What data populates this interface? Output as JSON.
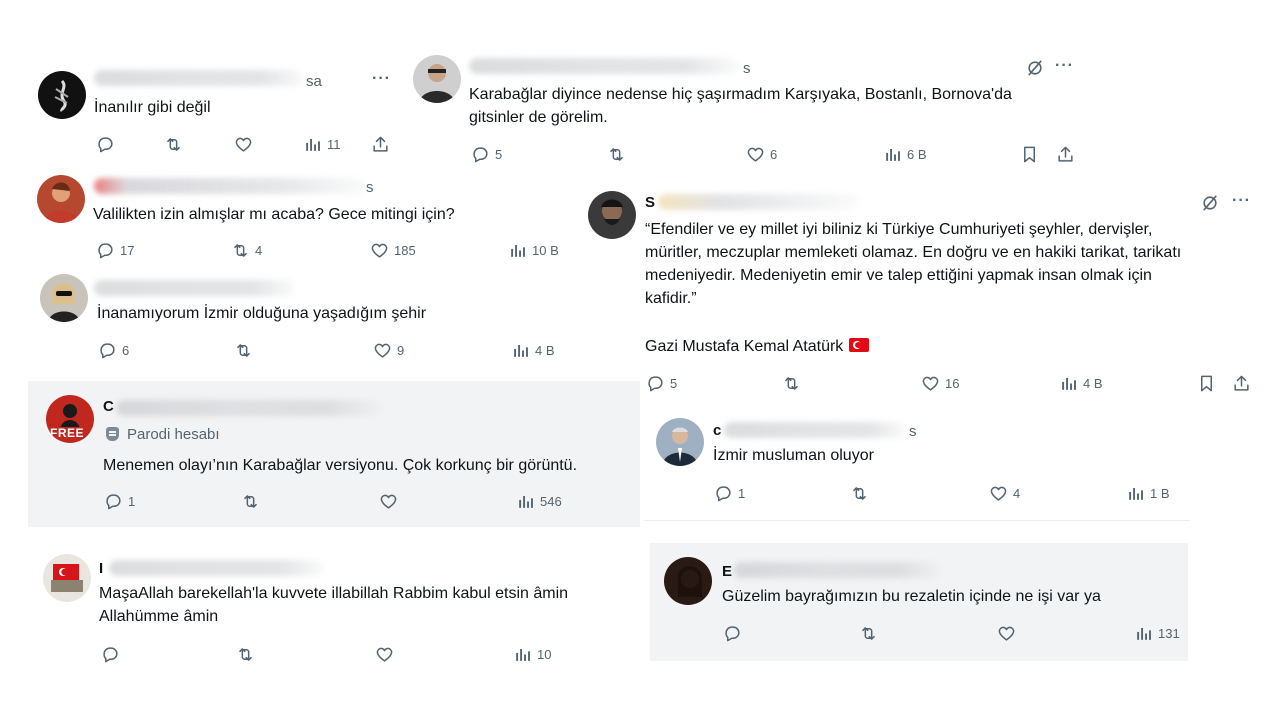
{
  "icons": {
    "reply": "reply-icon",
    "retweet": "retweet-icon",
    "like": "heart-icon",
    "views": "views-icon",
    "share": "share-icon",
    "bookmark": "bookmark-icon",
    "grok": "grok-icon",
    "more": "more-icon"
  },
  "colors": {
    "text": "#0f1419",
    "muted": "#536471",
    "card_gray": "#f2f3f4"
  },
  "posts": [
    {
      "name_visible": "",
      "time": "sa",
      "text": [
        "İnanılır gibi değil"
      ],
      "reply": "",
      "retweet": "",
      "like": "",
      "views": "11"
    },
    {
      "name_visible": "",
      "time": "s",
      "text": [
        "Karabağlar diyince nedense hiç şaşırmadım Karşıyaka, Bostanlı, Bornova'da",
        "gitsinler de görelim."
      ],
      "reply": "5",
      "retweet": "",
      "like": "6",
      "views": "6 B"
    },
    {
      "name_visible": "",
      "time": "s",
      "text": [
        "Valilikten izin almışlar mı acaba? Gece mitingi için?"
      ],
      "reply": "17",
      "retweet": "4",
      "like": "185",
      "views": "10 B"
    },
    {
      "name_visible": "S",
      "time": "",
      "text": [
        "“Efendiler ve ey millet iyi biliniz ki Türkiye Cumhuriyeti şeyhler, dervişler,",
        "müritler, meczuplar memleketi olamaz. En doğru ve en hakiki tarikat, tarikatı",
        "medeniyedir. Medeniyetin emir ve talep ettiğini yapmak insan olmak için",
        "kafidir.”"
      ],
      "signature": "Gazi Mustafa Kemal Atatürk",
      "reply": "5",
      "retweet": "",
      "like": "16",
      "views": "4 B"
    },
    {
      "name_visible": "",
      "time": "",
      "text": [
        "İnanamıyorum İzmir olduğuna yaşadığım şehir"
      ],
      "reply": "6",
      "retweet": "",
      "like": "9",
      "views": "4 B"
    },
    {
      "name_visible": "C",
      "time": "",
      "badge": "Parodi hesabı",
      "text": [
        "Menemen olayı’nın Karabağlar versiyonu. Çok korkunç bir görüntü."
      ],
      "reply": "1",
      "retweet": "",
      "like": "",
      "views": "546"
    },
    {
      "name_visible": "c",
      "time": "s",
      "text": [
        "İzmir musluman oluyor"
      ],
      "reply": "1",
      "retweet": "",
      "like": "4",
      "views": "1 B"
    },
    {
      "name_visible": "I",
      "time": "",
      "text": [
        "MaşaAllah barekellah'la kuvvete illabillah Rabbim kabul etsin âmin",
        "Allahümme âmin"
      ],
      "reply": "",
      "retweet": "",
      "like": "",
      "views": "10"
    },
    {
      "name_visible": "E",
      "time": "",
      "text": [
        "Güzelim bayrağımızın bu rezaletin içinde ne işi var ya"
      ],
      "reply": "",
      "retweet": "",
      "like": "",
      "views": "131"
    }
  ]
}
